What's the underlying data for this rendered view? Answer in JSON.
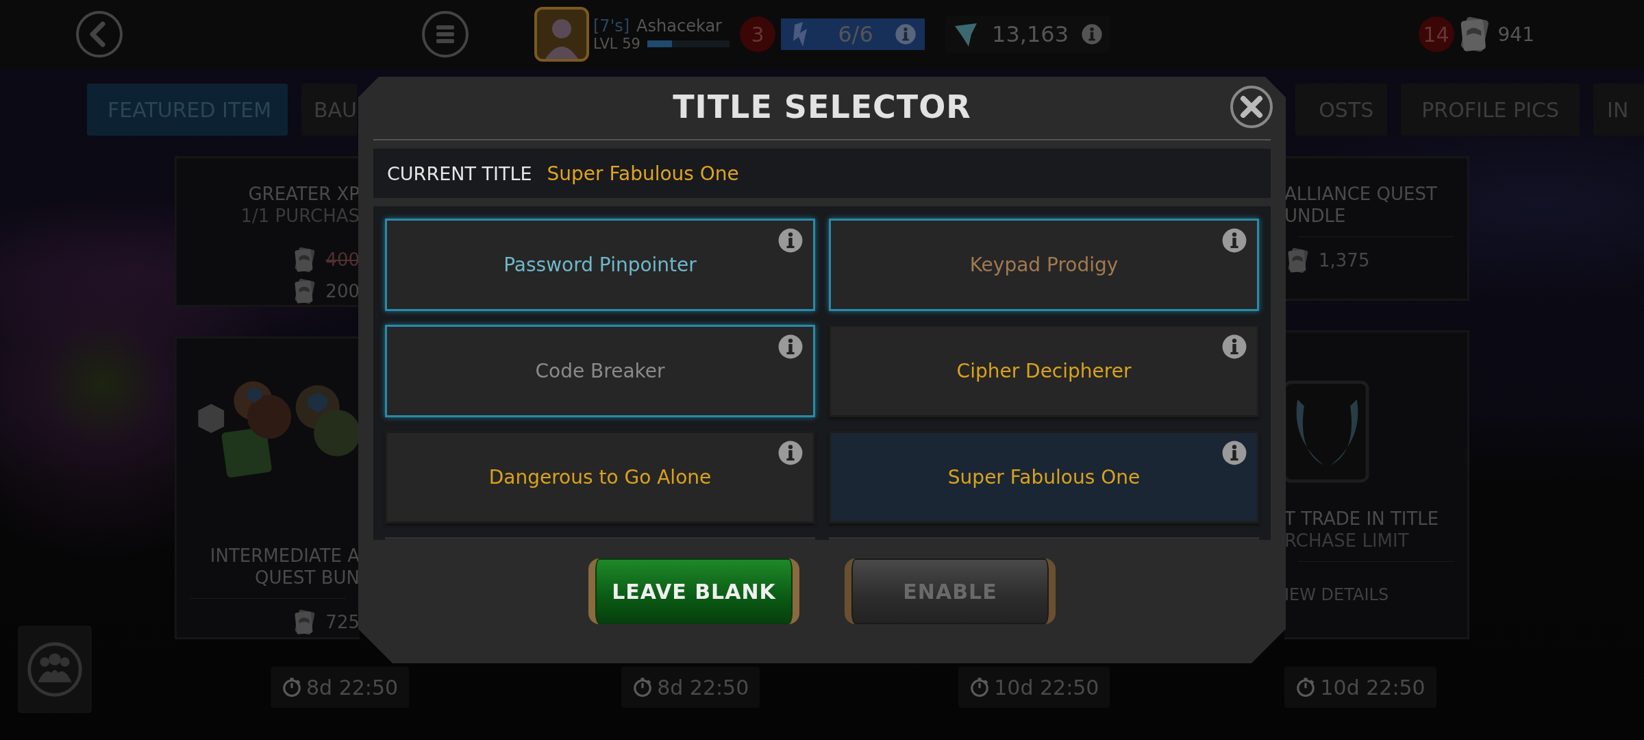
{
  "top_bar": {
    "player": {
      "tag": "[7's]",
      "name": "Ashacekar",
      "level_label": "LVL 59",
      "xp": {
        "level": 0.3
      }
    },
    "notification_badge": "3",
    "energy": {
      "value": "6/6"
    },
    "crystals": {
      "value": "13,163"
    },
    "units": {
      "badge": "14",
      "value": "941"
    }
  },
  "tabs": [
    {
      "label": "FEATURED ITEM",
      "selected": true
    },
    {
      "label": "BAU",
      "selected": false
    },
    {
      "label": "OSTS",
      "selected": false
    },
    {
      "label": "PROFILE PICS",
      "selected": false
    },
    {
      "label": "IN",
      "selected": false
    }
  ],
  "left_column": {
    "cards": [
      {
        "kind": "plain",
        "title_lines": [
          "GREATER XP"
        ],
        "subtitle": "1/1 PURCHAS",
        "prices": [
          {
            "amount": "400",
            "struck": true
          },
          {
            "amount": "200",
            "struck": false
          }
        ]
      },
      {
        "kind": "bundle",
        "title_lines": [
          "INTERMEDIATE A",
          "QUEST BUN"
        ],
        "prices": [
          {
            "amount": "725",
            "struck": false
          }
        ]
      }
    ]
  },
  "right_column": {
    "cards": [
      {
        "kind": "plain",
        "title_lines": [
          "ALLIANCE QUEST",
          "UNDLE"
        ],
        "prices": [
          {
            "amount": "1,375",
            "struck": false
          }
        ]
      },
      {
        "kind": "emblem",
        "title_lines": [
          "T TRADE IN TITLE"
        ],
        "subtitle": "RCHASE LIMIT",
        "link": "IEW DETAILS"
      }
    ]
  },
  "timers": [
    "8d 22:50",
    "8d 22:50",
    "10d 22:50",
    "10d 22:50"
  ],
  "dialog": {
    "title": "TITLE SELECTOR",
    "current_title": {
      "label": "CURRENT TITLE",
      "value": "Super Fabulous One"
    },
    "titles": [
      {
        "name": "Password Pinpointer",
        "color": "#6fb8c8",
        "highlighted": true,
        "selected": false
      },
      {
        "name": "Keypad Prodigy",
        "color": "#a07a50",
        "highlighted": true,
        "selected": false
      },
      {
        "name": "Code Breaker",
        "color": "#8a8a8a",
        "highlighted": true,
        "selected": false
      },
      {
        "name": "Cipher Decipherer",
        "color": "#d9a21b",
        "highlighted": false,
        "selected": false
      },
      {
        "name": "Dangerous to Go Alone",
        "color": "#d9a21b",
        "highlighted": false,
        "selected": false
      },
      {
        "name": "Super Fabulous One",
        "color": "#d9a21b",
        "highlighted": false,
        "selected": true
      }
    ],
    "buttons": [
      {
        "label": "LEAVE BLANK",
        "disabled": false
      },
      {
        "label": "ENABLE",
        "disabled": true
      }
    ]
  }
}
